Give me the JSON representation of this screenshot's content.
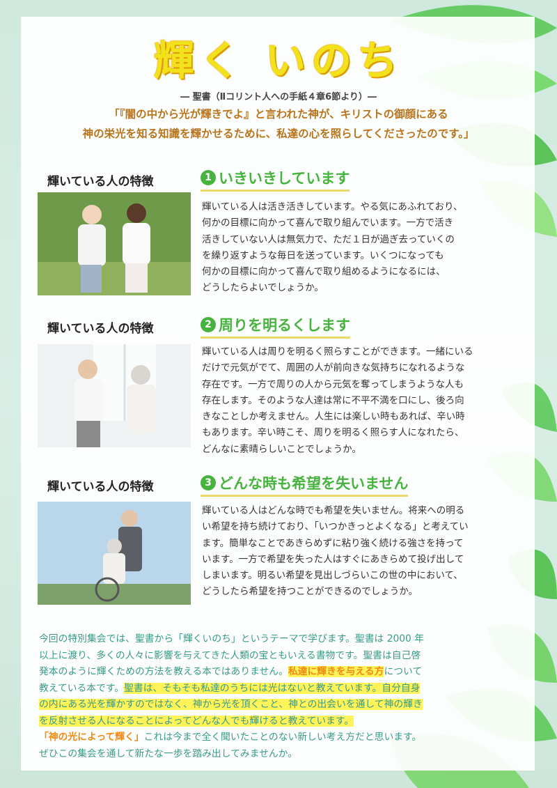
{
  "title": "輝く いのち",
  "source": "― 聖書（Ⅱコリント人への手紙４章6節より）―",
  "verse_line1": "「『闇の中から光が輝きでよ』と言われた神が、キリストの御顔にある",
  "verse_line2": "神の栄光を知る知識を輝かせるために、私達の心を照らしてくださったのです。」",
  "sections": [
    {
      "label": "輝いている人の特徴",
      "number": "1",
      "heading": "いきいきしています",
      "lines": [
        "輝いている人は活き活きしています。やる気にあふれており、",
        "何かの目標に向かって喜んで取り組んでいます。一方で活き",
        "活きしていない人は無気力で、ただ１日が過ぎ去っていくの",
        "を繰り返すような毎日を送っています。いくつになっても",
        "何かの目標に向かって喜んで取り組めるようになるには、",
        "どうしたらよいでしょうか。"
      ]
    },
    {
      "label": "輝いている人の特徴",
      "number": "2",
      "heading": "周りを明るくします",
      "lines": [
        "輝いている人は周りを明るく照らすことができます。一緒にいる",
        "だけで元気がでて、周囲の人が前向きな気持ちになれるような",
        "存在です。一方で周りの人から元気を奪ってしまうような人も",
        "存在します。そのような人達は常に不平不満を口にし、後ろ向",
        "きなことしか考えません。人生には楽しい時もあれば、辛い時",
        "もあります。辛い時こそ、周りを明るく照らす人になれたら、",
        "どんなに素晴らしいことでしょうか。"
      ]
    },
    {
      "label": "輝いている人の特徴",
      "number": "3",
      "heading": "どんな時も希望を失いません",
      "lines": [
        "輝いている人はどんな時でも希望を失いません。将来への明る",
        "い希望を持ち続けており、「いつかきっとよくなる」と考えてい",
        "ます。簡単なことであきらめずに粘り強く続ける強さを持って",
        "います。一方で希望を失った人はすぐにあきらめて投げ出して",
        "しまいます。明るい希望を見出しづらいこの世の中において、",
        "どうしたら希望を持つことができるのでしょうか。"
      ]
    }
  ],
  "closing": {
    "l1": "今回の特別集会では、聖書から「輝くいのち」というテーマで学びます。聖書は 2000 年",
    "l2": "以上に渡り、多くの人々に影響を与えてきた人類の宝ともいえる書物です。聖書は自己啓",
    "l3a": "発本のように輝くための方法を教える本ではありません。",
    "l3b": "私達に輝きを与える方",
    "l3c": "について",
    "l4a": "教えている本です。",
    "l4b": "聖書は、そもそも私達のうちには光はないと教えています。自分自身",
    "l5": "の内にある光を輝かすのではなく、神から光を頂くこと、神との出会いを通して神の輝き",
    "l6": "を反射させる人になることによってどんな人でも輝けると教えています。",
    "l7a": "「神の光によって輝く」",
    "l7b": "これは今まで全く聞いたことのない新しい考え方だと思います。",
    "l8": "ぜひこの集会を通して新たな一歩を踏み出してみませんか。"
  },
  "colors": {
    "green": "#47b33f",
    "gold": "#b8741c",
    "teal": "#3a9a88",
    "highlight": "#fff35a",
    "orange": "#f08a16"
  },
  "photos": [
    "jogging-couple-photo",
    "smiling-couple-photo",
    "wheelchair-couple-photo"
  ]
}
